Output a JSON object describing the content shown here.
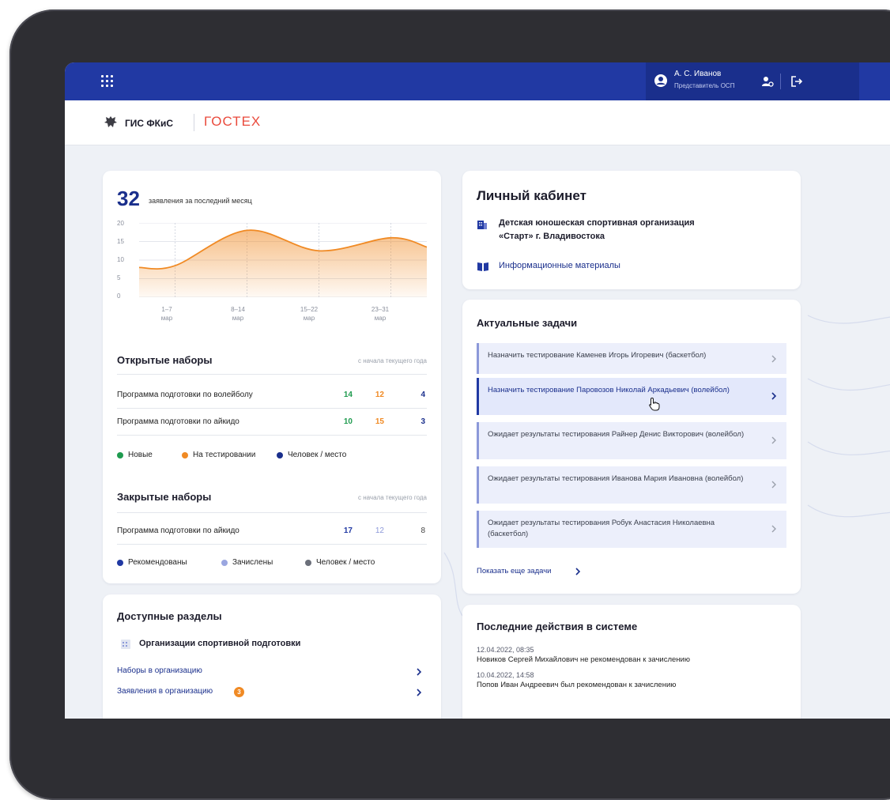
{
  "topbar": {
    "user_name": "А. С. Иванов",
    "user_role": "Представитель ОСП"
  },
  "header": {
    "system_name": "ГИС ФКиС",
    "partner_logo": "ГОСТЕХ"
  },
  "stats_card": {
    "count": "32",
    "caption": "заявления за последний месяц",
    "chart_data": {
      "type": "area",
      "categories": [
        "1–7 мар",
        "8–14 мар",
        "15–22 мар",
        "23–31 мар"
      ],
      "y_ticks": [
        0,
        5,
        10,
        15,
        20
      ],
      "ylim": [
        0,
        20
      ],
      "grid": true,
      "x": [
        0,
        0.5,
        1.5,
        2.5,
        3.5,
        4.0
      ],
      "values": [
        8,
        8.5,
        18,
        12.5,
        16,
        13.5
      ],
      "color": "#f08a24"
    },
    "chart_x_labels": [
      {
        "top": "1–7",
        "bottom": "мар"
      },
      {
        "top": "8–14",
        "bottom": "мар"
      },
      {
        "top": "15–22",
        "bottom": "мар"
      },
      {
        "top": "23–31",
        "bottom": "мар"
      }
    ],
    "y_labels": [
      "20",
      "15",
      "10",
      "5",
      "0"
    ],
    "open": {
      "title": "Открытые наборы",
      "hint": "с начала текущего года",
      "rows": [
        {
          "label": "Программа подготовки по волейболу",
          "a": "14",
          "b": "12",
          "c": "4"
        },
        {
          "label": "Программа подготовки по айкидо",
          "a": "10",
          "b": "15",
          "c": "3"
        }
      ],
      "legend": [
        "Новые",
        "На тестировании",
        "Человек / место"
      ],
      "colors": [
        "#1f9b4f",
        "#f08a24",
        "#1a2f8c"
      ]
    },
    "closed": {
      "title": "Закрытые наборы",
      "hint": "с начала текущего года",
      "rows": [
        {
          "label": "Программа подготовки по айкидо",
          "a": "17",
          "b": "12",
          "c": "8"
        }
      ],
      "legend": [
        "Рекомендованы",
        "Зачислены",
        "Человек / место"
      ],
      "colors": [
        "#2139a3",
        "#9aa6e0",
        "#6b6f7a"
      ]
    }
  },
  "sections_card": {
    "title": "Доступные разделы",
    "group_title": "Организации спортивной подготовки",
    "links": [
      {
        "label": "Наборы в организацию"
      },
      {
        "label": "Заявления в организацию",
        "badge": "3"
      }
    ]
  },
  "account_card": {
    "title": "Личный кабинет",
    "org_line1": "Детская юношеская спортивная организация",
    "org_line2": "«Старт» г. Владивостока",
    "info_link": "Информационные материалы"
  },
  "tasks_card": {
    "title": "Актуальные задачи",
    "tasks": [
      {
        "text": "Назначить тестирование Каменев Игорь Игоревич (баскетбол)"
      },
      {
        "text": "Назначить тестирование Паровозов Николай Аркадьевич (волейбол)"
      },
      {
        "text": "Ожидает результаты тестирования Райнер Денис Викторович (волейбол)"
      },
      {
        "text": "Ожидает результаты тестирования Иванова Мария Ивановна (волейбол)"
      },
      {
        "text": "Ожидает результаты тестирования Робук Анастасия Николаевна (баскетбол)"
      }
    ],
    "more_link": "Показать еще задачи"
  },
  "activity_card": {
    "title": "Последние действия в системе",
    "items": [
      {
        "date": "12.04.2022, 08:35",
        "text": "Новиков Сергей Михайлович не рекомендован к зачислению"
      },
      {
        "date": "10.04.2022, 14:58",
        "text": "Попов Иван Андреевич был рекомендован к зачислению"
      }
    ]
  }
}
